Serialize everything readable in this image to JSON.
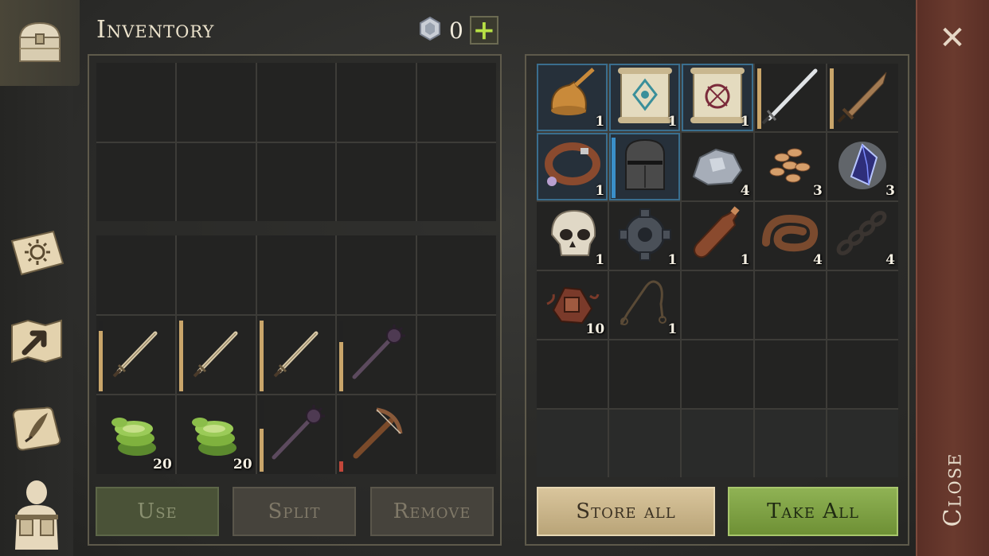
{
  "header": {
    "title": "Inventory",
    "currency_count": "0",
    "add_label": "+"
  },
  "sidebar": {
    "items": [
      {
        "name": "chest",
        "icon": "chest-icon",
        "active": true
      },
      {
        "name": "skills",
        "icon": "sun-book-icon",
        "active": false
      },
      {
        "name": "map",
        "icon": "map-arrow-icon",
        "active": false
      },
      {
        "name": "notes",
        "icon": "scroll-quill-icon",
        "active": false
      },
      {
        "name": "character",
        "icon": "character-backpack-icon",
        "active": false
      }
    ]
  },
  "player_inventory": {
    "top_grid": [
      {},
      {},
      {},
      {},
      {},
      {},
      {},
      {},
      {},
      {}
    ],
    "bottom_grid": [
      {},
      {},
      {},
      {},
      {},
      {
        "icon": "sword",
        "durability": 0.85,
        "dur_color": "#c9a56a"
      },
      {
        "icon": "sword",
        "durability": 1.0,
        "dur_color": "#c9a56a"
      },
      {
        "icon": "sword",
        "durability": 1.0,
        "dur_color": "#c9a56a"
      },
      {
        "icon": "mace",
        "durability": 0.7,
        "dur_color": "#c9a56a"
      },
      {},
      {
        "icon": "cactus",
        "qty": "20"
      },
      {
        "icon": "cactus",
        "qty": "20"
      },
      {
        "icon": "mace",
        "durability": 0.6,
        "dur_color": "#c9a56a"
      },
      {
        "icon": "crossbow",
        "durability": 0.15,
        "dur_color": "#c2473a"
      },
      {}
    ]
  },
  "container": {
    "slots": [
      {
        "icon": "bell",
        "qty": "1",
        "hl": true
      },
      {
        "icon": "scroll-blue",
        "qty": "1",
        "hl": true
      },
      {
        "icon": "scroll-red",
        "qty": "1",
        "hl": true
      },
      {
        "icon": "longsword",
        "durability": 1.0,
        "dur_color": "#c9a56a"
      },
      {
        "icon": "sword-short",
        "durability": 1.0,
        "dur_color": "#c9a56a"
      },
      {
        "icon": "collar",
        "qty": "1",
        "hl": true
      },
      {
        "icon": "helmet",
        "hl": true,
        "durability": 1.0,
        "dur_color": "#3a8fc9"
      },
      {
        "icon": "ore",
        "qty": "4"
      },
      {
        "icon": "seeds",
        "qty": "3"
      },
      {
        "icon": "crystal",
        "qty": "3"
      },
      {
        "icon": "skull",
        "qty": "1"
      },
      {
        "icon": "gear",
        "qty": "1"
      },
      {
        "icon": "bottle",
        "qty": "1"
      },
      {
        "icon": "leather",
        "qty": "4"
      },
      {
        "icon": "chain",
        "qty": "4"
      },
      {
        "icon": "scrap",
        "qty": "10"
      },
      {
        "icon": "rope",
        "qty": "1"
      },
      {},
      {},
      {},
      {},
      {},
      {},
      {},
      {},
      {
        "faded": true
      },
      {
        "faded": true
      },
      {
        "faded": true
      },
      {
        "faded": true
      },
      {
        "faded": true
      }
    ]
  },
  "buttons": {
    "use": "Use",
    "split": "Split",
    "remove": "Remove",
    "store_all": "Store all",
    "take_all": "Take All"
  },
  "close": {
    "label": "Close",
    "x_glyph": "✕"
  }
}
